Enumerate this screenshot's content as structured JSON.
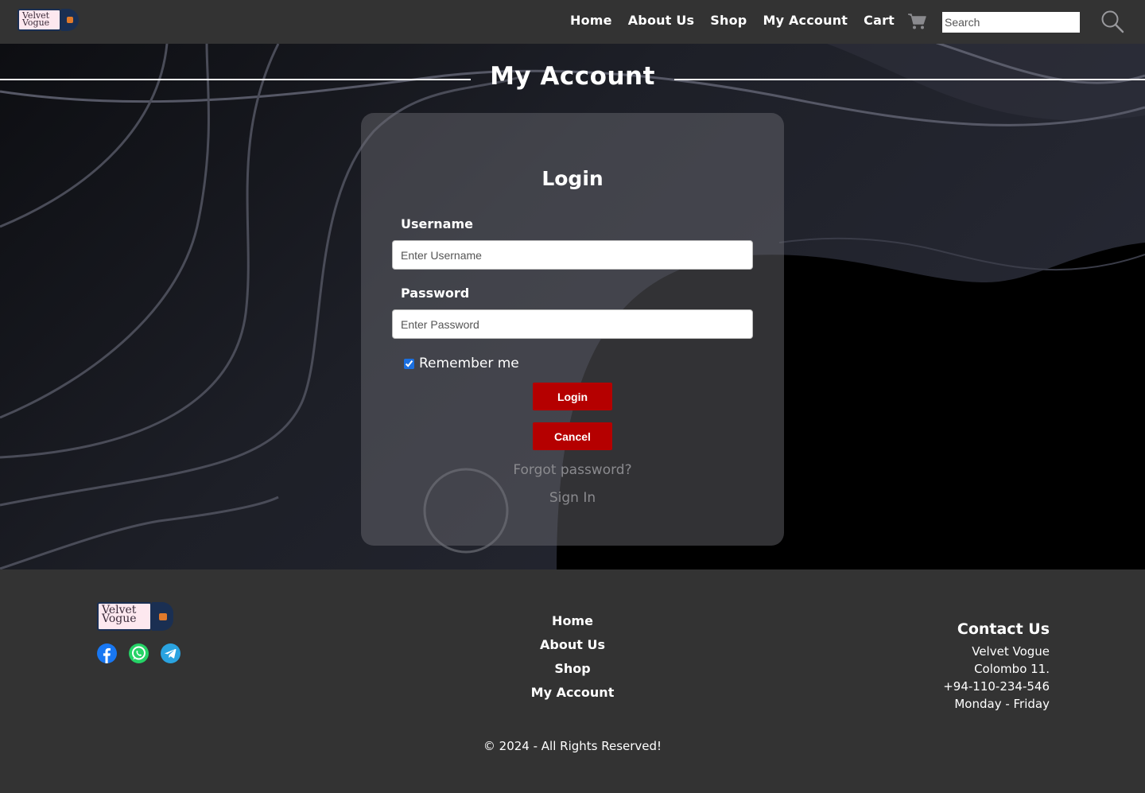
{
  "brand": {
    "line1": "Velvet",
    "line2": "Vogue"
  },
  "nav": {
    "links": [
      "Home",
      "About Us",
      "Shop",
      "My Account",
      "Cart"
    ],
    "search_placeholder": "Search"
  },
  "hero": {
    "title": "My Account",
    "login": {
      "heading": "Login",
      "username_label": "Username",
      "username_placeholder": "Enter Username",
      "password_label": "Password",
      "password_placeholder": "Enter Password",
      "remember_label": "Remember me",
      "remember_checked": true,
      "login_button": "Login",
      "cancel_button": "Cancel",
      "forgot_link": "Forgot password?",
      "signin_link": "Sign In"
    }
  },
  "footer": {
    "links": [
      "Home",
      "About Us",
      "Shop",
      "My Account"
    ],
    "contact": {
      "title": "Contact Us",
      "lines": [
        "Velvet Vogue",
        "Colombo 11.",
        "+94-110-234-546",
        "Monday - Friday"
      ]
    },
    "socials": [
      "facebook-icon",
      "whatsapp-icon",
      "telegram-icon"
    ],
    "copyright": "© 2024 - All Rights Reserved!"
  },
  "colors": {
    "nav_bg": "#333333",
    "button_red": "#b50000",
    "muted_link": "#8a8a8e"
  }
}
